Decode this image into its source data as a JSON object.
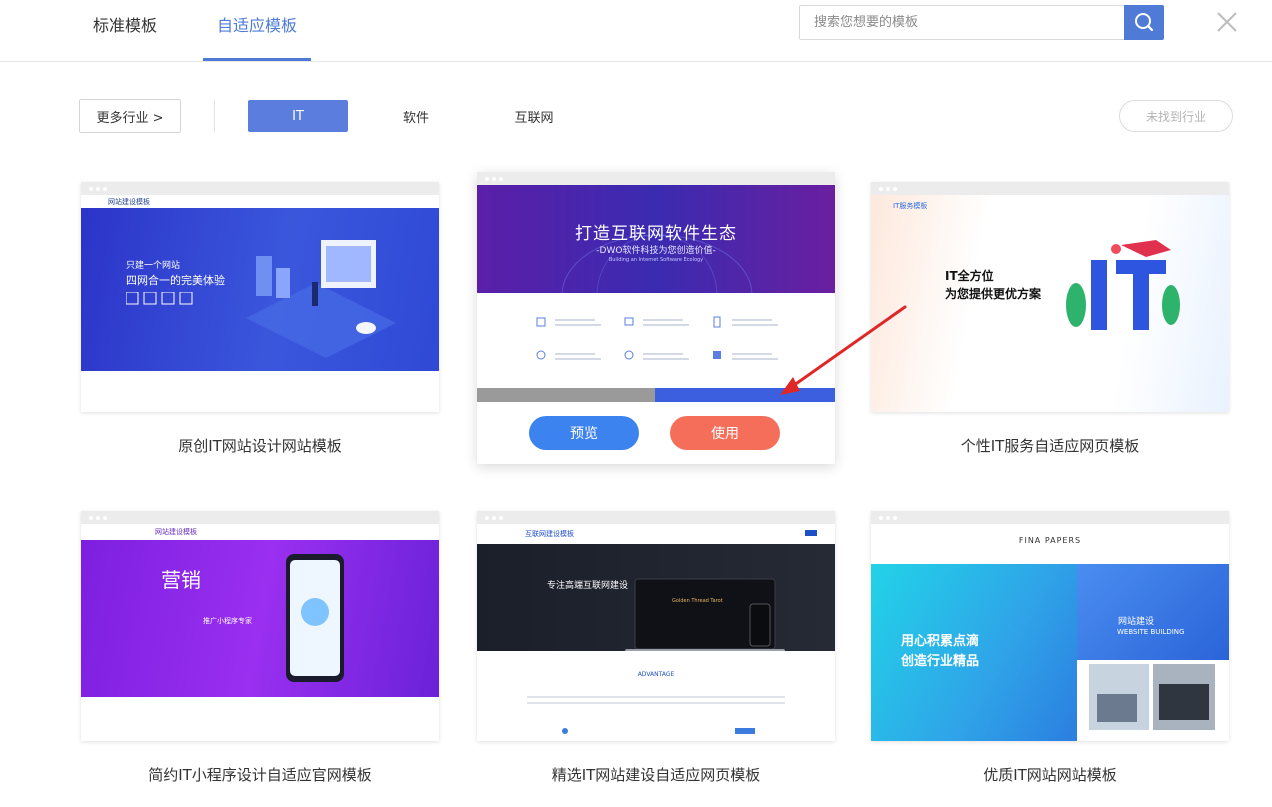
{
  "header": {
    "tabs": [
      {
        "label": "标准模板",
        "active": false
      },
      {
        "label": "自适应模板",
        "active": true
      }
    ],
    "search_placeholder": "搜索您想要的模板",
    "accent": "#4f7bd6"
  },
  "filters": {
    "more_label": "更多行业 >",
    "chips": [
      "IT",
      "软件",
      "互联网"
    ],
    "active_chip": "IT",
    "not_found_label": "未找到行业"
  },
  "cards": [
    {
      "title": "原创IT网站设计网站模板",
      "preview": {
        "site_name": "网站建设模板",
        "headline1": "只建一个网站",
        "headline2": "四网合一的完美体验"
      }
    },
    {
      "title": "",
      "preview": {
        "headline1": "打造互联网软件生态",
        "headline2": "-DWO软件科技为您创造价值-",
        "tagline": "Building an Internet Software Ecology"
      },
      "preview_button": "预览",
      "use_button": "使用"
    },
    {
      "title": "个性IT服务自适应网页模板",
      "preview": {
        "site_name": "IT服务模板",
        "headline1": "IT全方位",
        "headline2": "为您提供更优方案"
      }
    },
    {
      "title": "简约IT小程序设计自适应官网模板",
      "preview": {
        "site_name": "网站建设模板",
        "headline1": "营销",
        "headline2": "推广小程序专家"
      }
    },
    {
      "title": "精选IT网站建设自适应网页模板",
      "preview": {
        "site_name": "互联网建设模板",
        "headline1": "专注高端互联网建设",
        "headline2": "Golden Thread Tarot",
        "section": "ADVANTAGE"
      }
    },
    {
      "title": "优质IT网站网站模板",
      "preview": {
        "site_name": "FINA PAPERS",
        "headline1": "用心积累点滴",
        "headline2": "创造行业精品",
        "badge1": "网站建设",
        "badge2": "WEBSITE BUILDING"
      }
    }
  ]
}
